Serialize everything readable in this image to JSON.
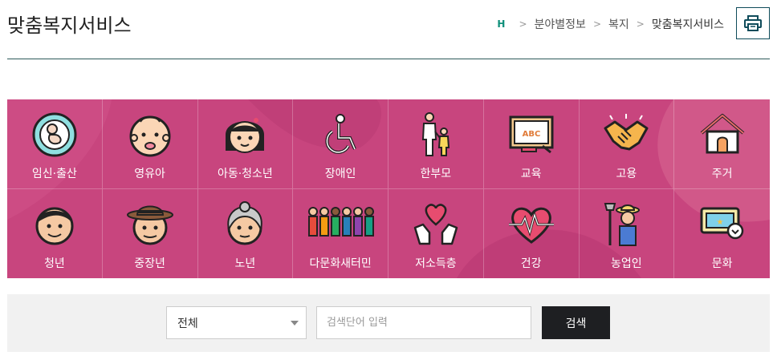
{
  "header": {
    "title": "맞춤복지서비스",
    "breadcrumb": {
      "home_icon": "H",
      "items": [
        "분야별정보",
        "복지",
        "맞춤복지서비스"
      ]
    },
    "print_icon": "printer-icon"
  },
  "categories": [
    {
      "label": "임신·출산",
      "icon": "pregnancy-icon"
    },
    {
      "label": "영유아",
      "icon": "infant-icon"
    },
    {
      "label": "아동·청소년",
      "icon": "child-icon"
    },
    {
      "label": "장애인",
      "icon": "wheelchair-icon"
    },
    {
      "label": "한부모",
      "icon": "single-parent-icon"
    },
    {
      "label": "교육",
      "icon": "blackboard-icon"
    },
    {
      "label": "고용",
      "icon": "handshake-icon"
    },
    {
      "label": "주거",
      "icon": "house-icon"
    },
    {
      "label": "청년",
      "icon": "young-man-icon"
    },
    {
      "label": "중장년",
      "icon": "middle-aged-man-icon"
    },
    {
      "label": "노년",
      "icon": "elderly-woman-icon"
    },
    {
      "label": "다문화새터민",
      "icon": "multicultural-people-icon"
    },
    {
      "label": "저소득층",
      "icon": "hands-heart-icon"
    },
    {
      "label": "건강",
      "icon": "heartbeat-icon"
    },
    {
      "label": "농업인",
      "icon": "farmer-icon"
    },
    {
      "label": "문화",
      "icon": "ticket-icon"
    }
  ],
  "colors": {
    "grid_bg": "#c8457e",
    "accent": "#0f8f7a",
    "search_button": "#1e1f22"
  },
  "search": {
    "select_value": "전체",
    "placeholder": "검색단어 입력",
    "button_label": "검색"
  }
}
